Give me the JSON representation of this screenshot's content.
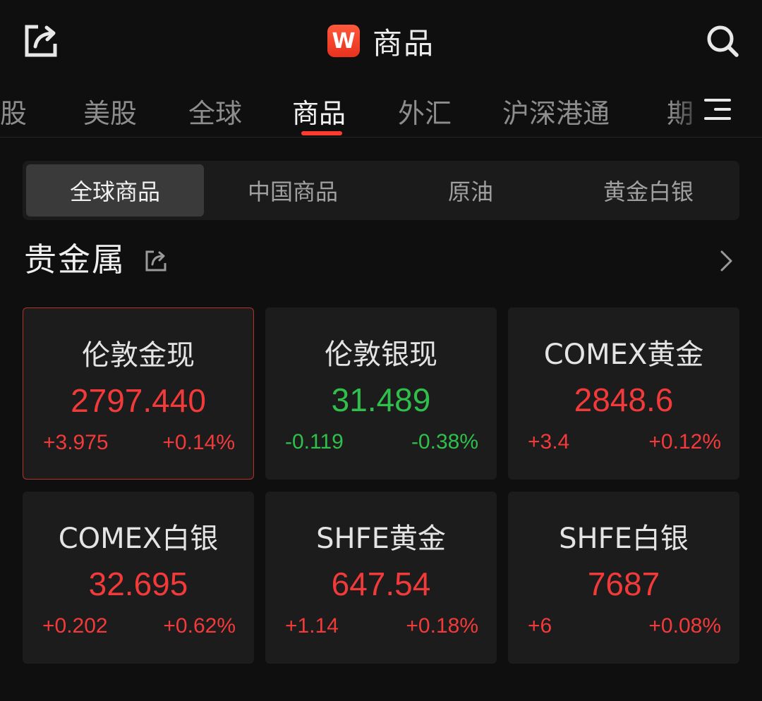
{
  "header": {
    "logo_letter": "W",
    "title": "商品"
  },
  "tabs": [
    {
      "label": "港股"
    },
    {
      "label": "美股"
    },
    {
      "label": "全球"
    },
    {
      "label": "商品",
      "active": true
    },
    {
      "label": "外汇"
    },
    {
      "label": "沪深港通"
    },
    {
      "label": "期"
    }
  ],
  "segments": [
    {
      "label": "全球商品",
      "active": true
    },
    {
      "label": "中国商品"
    },
    {
      "label": "原油"
    },
    {
      "label": "黄金白银"
    }
  ],
  "section": {
    "title": "贵金属"
  },
  "cards": [
    {
      "name": "伦敦金现",
      "price": "2797.440",
      "change": "+3.975",
      "pct": "+0.14%",
      "direction": "up",
      "selected": true
    },
    {
      "name": "伦敦银现",
      "price": "31.489",
      "change": "-0.119",
      "pct": "-0.38%",
      "direction": "down"
    },
    {
      "name": "COMEX黄金",
      "price": "2848.6",
      "change": "+3.4",
      "pct": "+0.12%",
      "direction": "up"
    },
    {
      "name": "COMEX白银",
      "price": "32.695",
      "change": "+0.202",
      "pct": "+0.62%",
      "direction": "up"
    },
    {
      "name": "SHFE黄金",
      "price": "647.54",
      "change": "+1.14",
      "pct": "+0.18%",
      "direction": "up"
    },
    {
      "name": "SHFE白银",
      "price": "7687",
      "change": "+6",
      "pct": "+0.08%",
      "direction": "up"
    }
  ],
  "colors": {
    "up": "#f23a3a",
    "down": "#2fbf4a",
    "accent": "#ff3b30",
    "background": "#0f0f0f",
    "card": "#1c1c1c"
  },
  "icons": {
    "share": "share-icon",
    "search": "search-icon",
    "menu": "menu-icon",
    "chevron": "chevron-right-icon"
  }
}
